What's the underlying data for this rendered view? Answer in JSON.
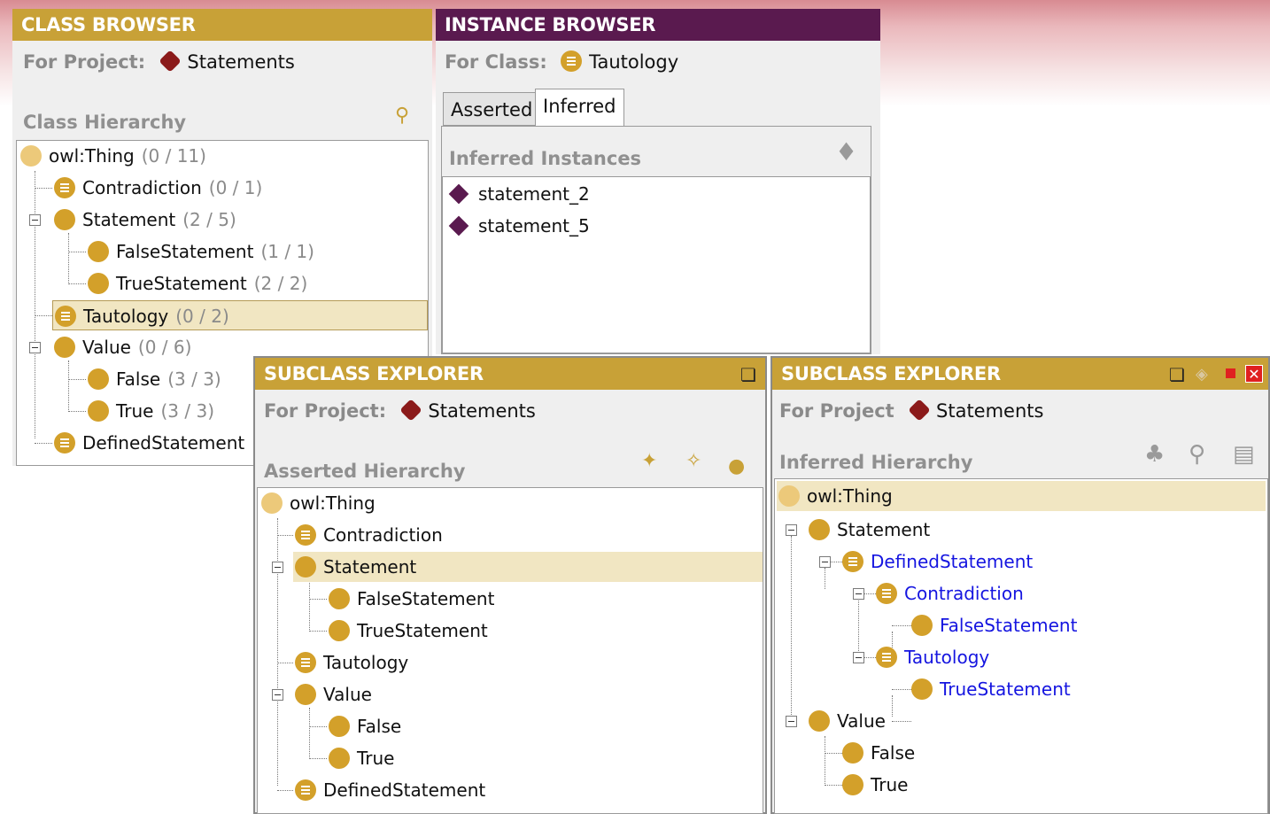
{
  "class_browser": {
    "title": "CLASS BROWSER",
    "project_label": "For Project:",
    "project_name": "Statements",
    "section": "Class Hierarchy",
    "tree": [
      {
        "label": "owl:Thing",
        "count": "(0 / 11)"
      },
      {
        "label": "Contradiction",
        "count": "(0 / 1)"
      },
      {
        "label": "Statement",
        "count": "(2 / 5)"
      },
      {
        "label": "FalseStatement",
        "count": "(1 / 1)"
      },
      {
        "label": "TrueStatement",
        "count": "(2 / 2)"
      },
      {
        "label": "Tautology",
        "count": "(0 / 2)"
      },
      {
        "label": "Value",
        "count": "(0 / 6)"
      },
      {
        "label": "False",
        "count": "(3 / 3)"
      },
      {
        "label": "True",
        "count": "(3 / 3)"
      },
      {
        "label": "DefinedStatement",
        "count": ""
      }
    ]
  },
  "instance_browser": {
    "title": "INSTANCE BROWSER",
    "class_label": "For Class:",
    "class_name": "Tautology",
    "tabs": [
      "Asserted",
      "Inferred"
    ],
    "section": "Inferred Instances",
    "instances": [
      "statement_2",
      "statement_5"
    ]
  },
  "subclass_left": {
    "title": "SUBCLASS EXPLORER",
    "project_label": "For Project:",
    "project_name": "Statements",
    "section": "Asserted Hierarchy",
    "tree": [
      "owl:Thing",
      "Contradiction",
      "Statement",
      "FalseStatement",
      "TrueStatement",
      "Tautology",
      "Value",
      "False",
      "True",
      "DefinedStatement"
    ]
  },
  "subclass_right": {
    "title": "SUBCLASS EXPLORER",
    "project_label": "For Project",
    "project_name": "Statements",
    "section": "Inferred Hierarchy",
    "tree": [
      "owl:Thing",
      "Statement",
      "DefinedStatement",
      "Contradiction",
      "FalseStatement",
      "Tautology",
      "TrueStatement",
      "Value",
      "False",
      "True"
    ]
  },
  "colors": {
    "gold": "#c8a137",
    "purple": "#5a1a4f",
    "inferred_text": "#1515e0"
  }
}
